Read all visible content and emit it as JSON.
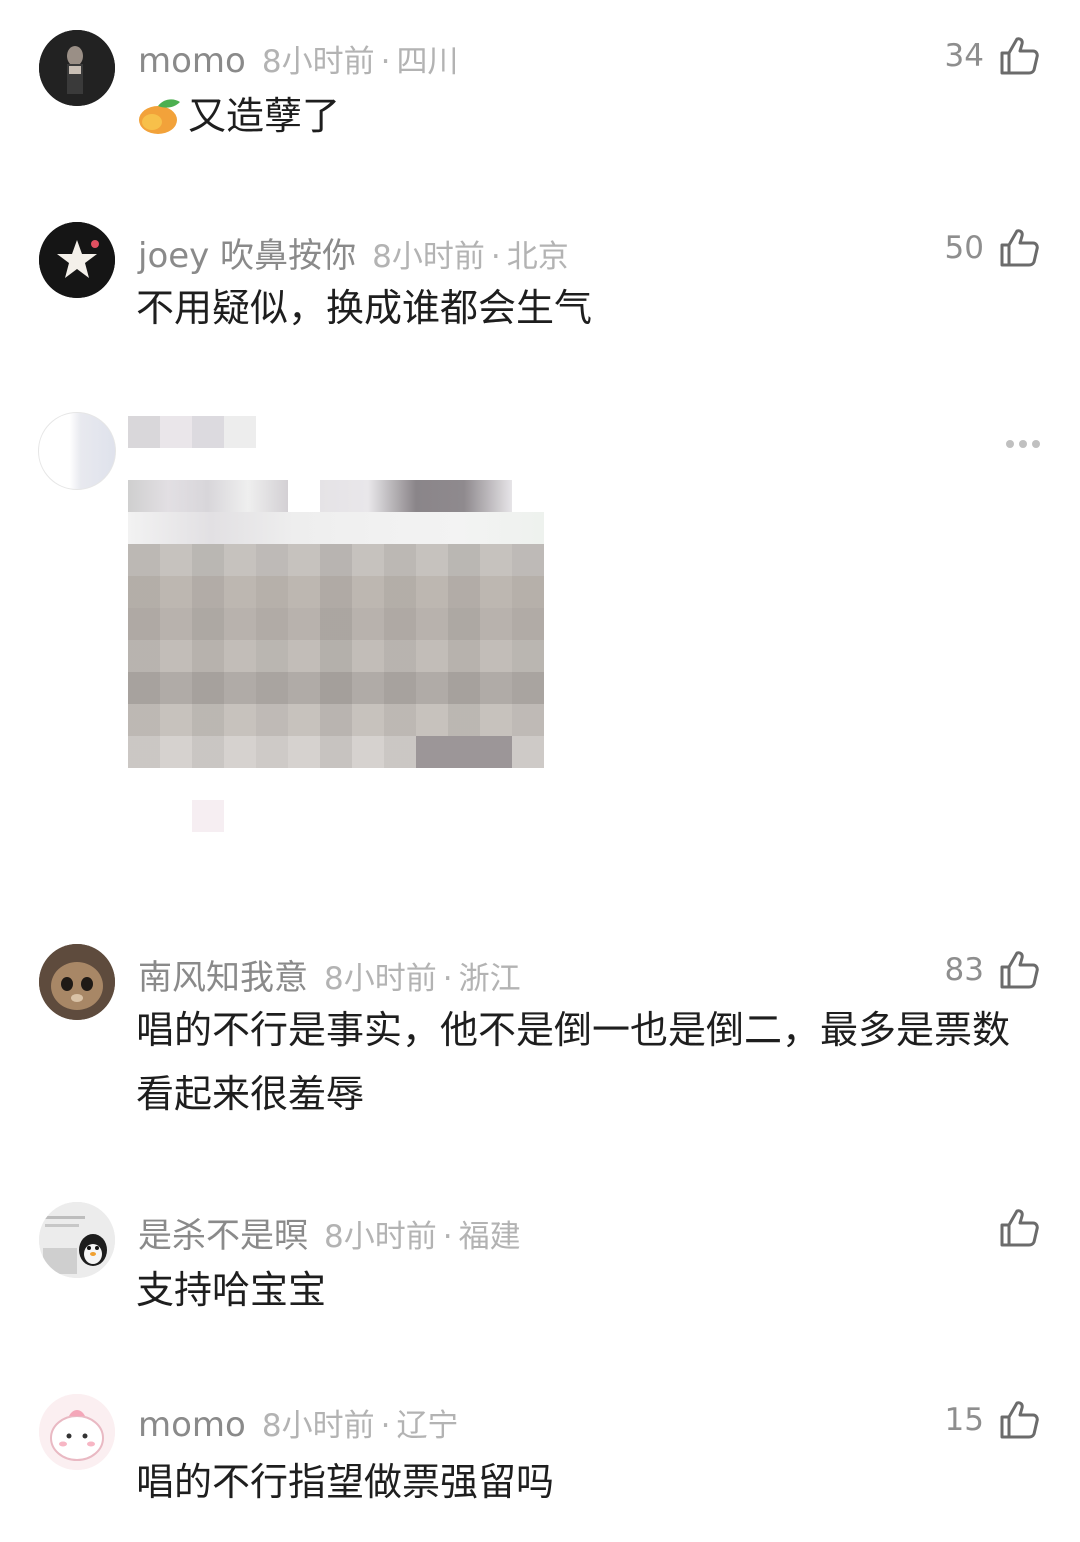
{
  "comments": [
    {
      "name": "momo",
      "time": "8小时前",
      "location": "四川",
      "likes": "34",
      "text": "又造孽了",
      "emoji": "mango-icon"
    },
    {
      "name": "joey 吹鼻按你",
      "time": "8小时前",
      "location": "北京",
      "likes": "50",
      "text": "不用疑似，换成谁都会生气"
    },
    {
      "name": "南风知我意",
      "time": "8小时前",
      "location": "浙江",
      "likes": "83",
      "text": "唱的不行是事实，他不是倒一也是倒二，最多是票数看起来很羞辱"
    },
    {
      "name": "是杀不是暝",
      "time": "8小时前",
      "location": "福建",
      "likes": "",
      "text": "支持哈宝宝"
    },
    {
      "name": "momo",
      "time": "8小时前",
      "location": "辽宁",
      "likes": "15",
      "text": "唱的不行指望做票强留吗"
    }
  ],
  "separator": "·",
  "colors": {
    "name": "#8a8a8a",
    "meta": "#b3b3b3",
    "text": "#1e1e1e",
    "icon": "#6b6b6b"
  }
}
